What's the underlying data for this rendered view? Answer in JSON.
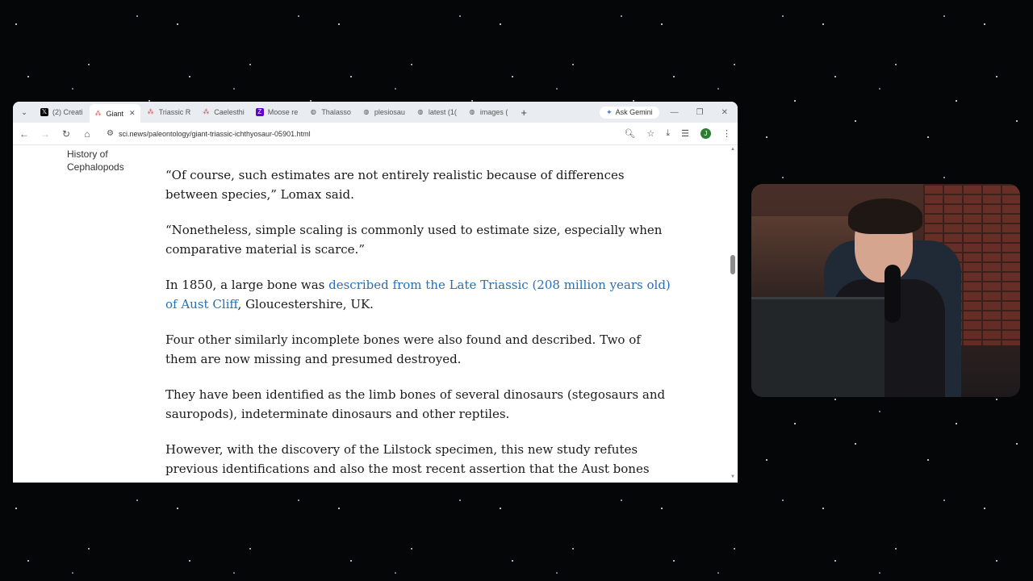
{
  "browser": {
    "tabs": [
      {
        "title": "(2) Creati",
        "icon": "x-logo-icon",
        "active": false
      },
      {
        "title": "Giant",
        "icon": "sci-news-icon",
        "active": true
      },
      {
        "title": "Triassic R",
        "icon": "sci-news-icon",
        "active": false
      },
      {
        "title": "Caelesthi",
        "icon": "sci-news-icon",
        "active": false
      },
      {
        "title": "Moose re",
        "icon": "yahoo-icon",
        "active": false
      },
      {
        "title": "Thalasso",
        "icon": "globe-icon",
        "active": false
      },
      {
        "title": "plesiosau",
        "icon": "globe-icon",
        "active": false
      },
      {
        "title": "latest (1(",
        "icon": "globe-icon",
        "active": false
      },
      {
        "title": "images (",
        "icon": "globe-icon",
        "active": false
      }
    ],
    "gemini_label": "Ask Gemini",
    "url": "sci.news/paleontology/giant-triassic-ichthyosaur-05901.html",
    "profile_initial": "J"
  },
  "sidebar": {
    "link": "History of Cephalopods"
  },
  "article": {
    "p1": "“Of course, such estimates are not entirely realistic because of differences between species,” Lomax said.",
    "p2": "“Nonetheless, simple scaling is commonly used to estimate size, especially when comparative material is scarce.”",
    "p3_before": "In 1850, a large bone was ",
    "p3_link": "described from the Late Triassic (208 million years old) of Aust Cliff",
    "p3_after": ", Gloucestershire, UK.",
    "p4": "Four other similarly incomplete bones were also found and described. Two of them are now missing and presumed destroyed.",
    "p5": "They have been identified as the limb bones of several dinosaurs (stegosaurs and sauropods), indeterminate dinosaurs and other reptiles.",
    "p6": "However, with the discovery of the Lilstock specimen, this new study refutes previous identifications and also the most recent assertion that the Aust bones"
  },
  "colors": {
    "link": "#2a6fb0",
    "tabstrip": "#e9edf2"
  }
}
